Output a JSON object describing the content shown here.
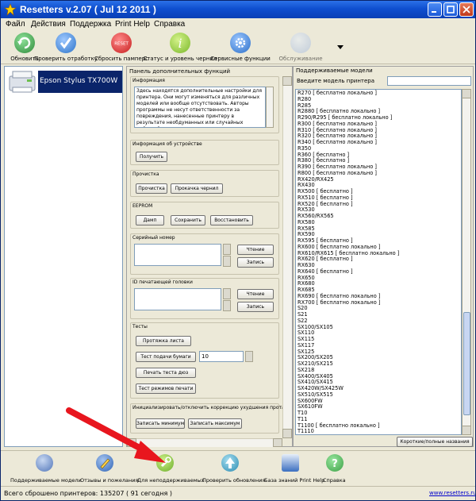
{
  "window": {
    "title": "Resetters v.2.07 ( Jul 12 2011 )"
  },
  "menu": [
    "Файл",
    "Действия",
    "Поддержка",
    "Print Help",
    "Справка"
  ],
  "toolbar": [
    {
      "label": "Обновить",
      "color": "#2f8a3a"
    },
    {
      "label": "Проверить отработку",
      "color": "#2c74c9"
    },
    {
      "label": "Сбросить памперс",
      "color": "#c61e1e",
      "badge": "RESET"
    },
    {
      "label": "Статус и уровень чернил",
      "color": "#7ab82a",
      "badge": "i"
    },
    {
      "label": "Сервисные функции",
      "color": "#2a6ec8"
    },
    {
      "label": "Обслуживание",
      "color": "#9fb5da"
    }
  ],
  "printer": {
    "name": "Epson Stylus TX700W"
  },
  "func_panel": {
    "title": "Панель дополнительных функций",
    "info": {
      "title": "Информация",
      "text": "Здесь находятся дополнительные настройки для принтера. Они могут изменяться для различных моделей или вообще отсутствовать. Авторы программы не несут ответственности за повреждения, нанесенные принтеру в результате необдуманных или случайных действий пользователя."
    },
    "device_info": {
      "title": "Информация об устройстве",
      "get_label": "Получить"
    },
    "cleaning": {
      "title": "Прочистка",
      "clean_label": "Прочистка",
      "ink_flush_label": "Прокачка чернил"
    },
    "eeprom": {
      "title": "EEPROM",
      "dump_label": "Дамп",
      "save_label": "Сохранить",
      "restore_label": "Восстановить"
    },
    "serial": {
      "title": "Серийный номер",
      "read_label": "Чтение",
      "write_label": "Запись"
    },
    "head_id": {
      "title": "ID печатающей головки",
      "read_label": "Чтение",
      "write_label": "Запись"
    },
    "tests": {
      "title": "Тесты",
      "sheet_feed_label": "Протяжка листа",
      "paper_feed_test_label": "Тест подачи бумаги",
      "paper_feed_value": "10",
      "nozzle_test_label": "Печать теста дюз",
      "print_modes_label": "Тест режимов печати"
    },
    "correction": {
      "title": "Инициализировать/отключить коррекцию ухудшения прота",
      "write_min_label": "Записать минимум",
      "write_max_label": "Записать максимум"
    }
  },
  "models_panel": {
    "title": "Поддерживаемые модели",
    "search_label": "Введите модель принтера",
    "search_value": "",
    "short_full_label": "Короткие/полные названия",
    "models": [
      "R270 [ бесплатно  локально ]",
      "R280",
      "R285",
      "R2880 [ бесплатно  локально ]",
      "R290/R295 [ бесплатно  локально ]",
      "R300 [ бесплатно  локально ]",
      "R310 [ бесплатно  локально ]",
      "R320 [ бесплатно  локально ]",
      "R340 [ бесплатно  локально ]",
      "R350",
      "R360 [ бесплатно ]",
      "R380 [ бесплатно ]",
      "R390 [ бесплатно  локально ]",
      "R800 [ бесплатно  локально ]",
      "RX420/RX425",
      "RX430",
      "RX500 [ бесплатно ]",
      "RX510 [ бесплатно ]",
      "RX520 [ бесплатно ]",
      "RX530",
      "RX560/RX565",
      "RX580",
      "RX585",
      "RX590",
      "RX595 [ бесплатно ]",
      "RX600 [ бесплатно  локально ]",
      "RX610/RX615 [ бесплатно  локально ]",
      "RX620 [ бесплатно ]",
      "RX630",
      "RX640 [ бесплатно ]",
      "RX650",
      "RX680",
      "RX685",
      "RX690 [ бесплатно  локально ]",
      "RX700 [ бесплатно  локально ]",
      "S20",
      "S21",
      "S22",
      "SX100/SX105",
      "SX110",
      "SX115",
      "SX117",
      "SX125",
      "SX200/SX205",
      "SX210/SX215",
      "SX218",
      "SX400/SX405",
      "SX410/SX415",
      "SX420W/SX425W",
      "SX510/SX515",
      "SX600FW",
      "SX610FW",
      "T10",
      "T11",
      "T1100 [ бесплатно  локально ]",
      "T1110"
    ]
  },
  "bottom_toolbar": [
    {
      "label": "Поддерживаемые модели",
      "color": "#4f74b8"
    },
    {
      "label": "Отзывы и пожелания",
      "color": "#2d62b5"
    },
    {
      "label": "Для неподдерживаемых",
      "color": "#6cae2a"
    },
    {
      "label": "Проверить обновления",
      "color": "#2a8ab0"
    },
    {
      "label": "База знаний Print Help",
      "color": "#3b6fc0"
    },
    {
      "label": "Справка",
      "color": "#3aa044",
      "badge": "?"
    }
  ],
  "status": {
    "text": "Всего сброшено принтеров:  135207 ( 91 сегодня )",
    "link": "www.resetters.ru"
  },
  "colors": {
    "titlebar": "#0f4fcf",
    "accent_arrow": "#e8161e",
    "selection": "#0a246a"
  }
}
